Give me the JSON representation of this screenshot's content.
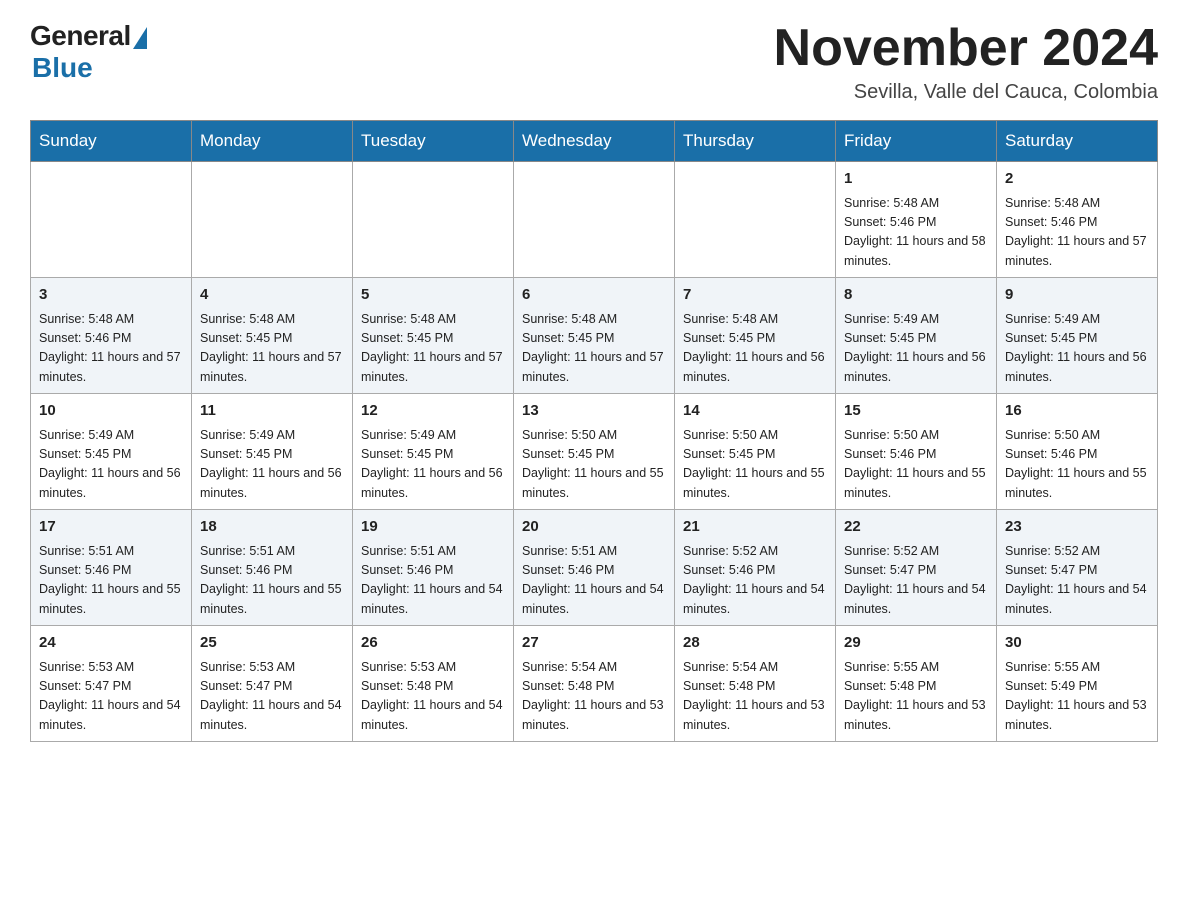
{
  "header": {
    "logo_general": "General",
    "logo_blue": "Blue",
    "month_title": "November 2024",
    "location": "Sevilla, Valle del Cauca, Colombia"
  },
  "days_of_week": [
    "Sunday",
    "Monday",
    "Tuesday",
    "Wednesday",
    "Thursday",
    "Friday",
    "Saturday"
  ],
  "weeks": [
    [
      {
        "day": "",
        "sunrise": "",
        "sunset": "",
        "daylight": ""
      },
      {
        "day": "",
        "sunrise": "",
        "sunset": "",
        "daylight": ""
      },
      {
        "day": "",
        "sunrise": "",
        "sunset": "",
        "daylight": ""
      },
      {
        "day": "",
        "sunrise": "",
        "sunset": "",
        "daylight": ""
      },
      {
        "day": "",
        "sunrise": "",
        "sunset": "",
        "daylight": ""
      },
      {
        "day": "1",
        "sunrise": "Sunrise: 5:48 AM",
        "sunset": "Sunset: 5:46 PM",
        "daylight": "Daylight: 11 hours and 58 minutes."
      },
      {
        "day": "2",
        "sunrise": "Sunrise: 5:48 AM",
        "sunset": "Sunset: 5:46 PM",
        "daylight": "Daylight: 11 hours and 57 minutes."
      }
    ],
    [
      {
        "day": "3",
        "sunrise": "Sunrise: 5:48 AM",
        "sunset": "Sunset: 5:46 PM",
        "daylight": "Daylight: 11 hours and 57 minutes."
      },
      {
        "day": "4",
        "sunrise": "Sunrise: 5:48 AM",
        "sunset": "Sunset: 5:45 PM",
        "daylight": "Daylight: 11 hours and 57 minutes."
      },
      {
        "day": "5",
        "sunrise": "Sunrise: 5:48 AM",
        "sunset": "Sunset: 5:45 PM",
        "daylight": "Daylight: 11 hours and 57 minutes."
      },
      {
        "day": "6",
        "sunrise": "Sunrise: 5:48 AM",
        "sunset": "Sunset: 5:45 PM",
        "daylight": "Daylight: 11 hours and 57 minutes."
      },
      {
        "day": "7",
        "sunrise": "Sunrise: 5:48 AM",
        "sunset": "Sunset: 5:45 PM",
        "daylight": "Daylight: 11 hours and 56 minutes."
      },
      {
        "day": "8",
        "sunrise": "Sunrise: 5:49 AM",
        "sunset": "Sunset: 5:45 PM",
        "daylight": "Daylight: 11 hours and 56 minutes."
      },
      {
        "day": "9",
        "sunrise": "Sunrise: 5:49 AM",
        "sunset": "Sunset: 5:45 PM",
        "daylight": "Daylight: 11 hours and 56 minutes."
      }
    ],
    [
      {
        "day": "10",
        "sunrise": "Sunrise: 5:49 AM",
        "sunset": "Sunset: 5:45 PM",
        "daylight": "Daylight: 11 hours and 56 minutes."
      },
      {
        "day": "11",
        "sunrise": "Sunrise: 5:49 AM",
        "sunset": "Sunset: 5:45 PM",
        "daylight": "Daylight: 11 hours and 56 minutes."
      },
      {
        "day": "12",
        "sunrise": "Sunrise: 5:49 AM",
        "sunset": "Sunset: 5:45 PM",
        "daylight": "Daylight: 11 hours and 56 minutes."
      },
      {
        "day": "13",
        "sunrise": "Sunrise: 5:50 AM",
        "sunset": "Sunset: 5:45 PM",
        "daylight": "Daylight: 11 hours and 55 minutes."
      },
      {
        "day": "14",
        "sunrise": "Sunrise: 5:50 AM",
        "sunset": "Sunset: 5:45 PM",
        "daylight": "Daylight: 11 hours and 55 minutes."
      },
      {
        "day": "15",
        "sunrise": "Sunrise: 5:50 AM",
        "sunset": "Sunset: 5:46 PM",
        "daylight": "Daylight: 11 hours and 55 minutes."
      },
      {
        "day": "16",
        "sunrise": "Sunrise: 5:50 AM",
        "sunset": "Sunset: 5:46 PM",
        "daylight": "Daylight: 11 hours and 55 minutes."
      }
    ],
    [
      {
        "day": "17",
        "sunrise": "Sunrise: 5:51 AM",
        "sunset": "Sunset: 5:46 PM",
        "daylight": "Daylight: 11 hours and 55 minutes."
      },
      {
        "day": "18",
        "sunrise": "Sunrise: 5:51 AM",
        "sunset": "Sunset: 5:46 PM",
        "daylight": "Daylight: 11 hours and 55 minutes."
      },
      {
        "day": "19",
        "sunrise": "Sunrise: 5:51 AM",
        "sunset": "Sunset: 5:46 PM",
        "daylight": "Daylight: 11 hours and 54 minutes."
      },
      {
        "day": "20",
        "sunrise": "Sunrise: 5:51 AM",
        "sunset": "Sunset: 5:46 PM",
        "daylight": "Daylight: 11 hours and 54 minutes."
      },
      {
        "day": "21",
        "sunrise": "Sunrise: 5:52 AM",
        "sunset": "Sunset: 5:46 PM",
        "daylight": "Daylight: 11 hours and 54 minutes."
      },
      {
        "day": "22",
        "sunrise": "Sunrise: 5:52 AM",
        "sunset": "Sunset: 5:47 PM",
        "daylight": "Daylight: 11 hours and 54 minutes."
      },
      {
        "day": "23",
        "sunrise": "Sunrise: 5:52 AM",
        "sunset": "Sunset: 5:47 PM",
        "daylight": "Daylight: 11 hours and 54 minutes."
      }
    ],
    [
      {
        "day": "24",
        "sunrise": "Sunrise: 5:53 AM",
        "sunset": "Sunset: 5:47 PM",
        "daylight": "Daylight: 11 hours and 54 minutes."
      },
      {
        "day": "25",
        "sunrise": "Sunrise: 5:53 AM",
        "sunset": "Sunset: 5:47 PM",
        "daylight": "Daylight: 11 hours and 54 minutes."
      },
      {
        "day": "26",
        "sunrise": "Sunrise: 5:53 AM",
        "sunset": "Sunset: 5:48 PM",
        "daylight": "Daylight: 11 hours and 54 minutes."
      },
      {
        "day": "27",
        "sunrise": "Sunrise: 5:54 AM",
        "sunset": "Sunset: 5:48 PM",
        "daylight": "Daylight: 11 hours and 53 minutes."
      },
      {
        "day": "28",
        "sunrise": "Sunrise: 5:54 AM",
        "sunset": "Sunset: 5:48 PM",
        "daylight": "Daylight: 11 hours and 53 minutes."
      },
      {
        "day": "29",
        "sunrise": "Sunrise: 5:55 AM",
        "sunset": "Sunset: 5:48 PM",
        "daylight": "Daylight: 11 hours and 53 minutes."
      },
      {
        "day": "30",
        "sunrise": "Sunrise: 5:55 AM",
        "sunset": "Sunset: 5:49 PM",
        "daylight": "Daylight: 11 hours and 53 minutes."
      }
    ]
  ]
}
